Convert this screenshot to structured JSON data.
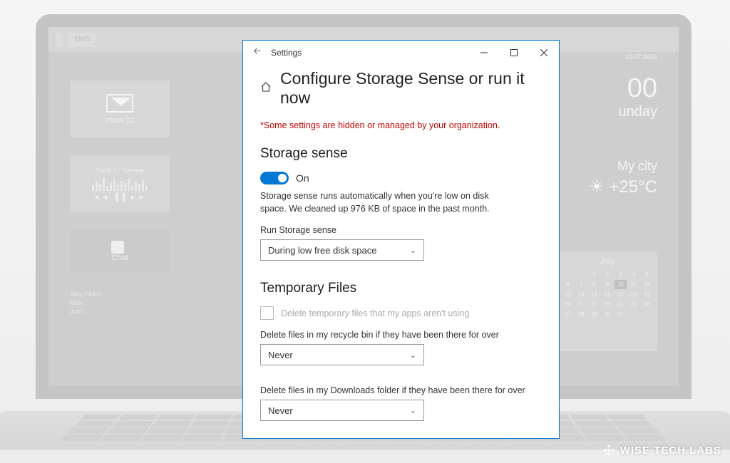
{
  "bg": {
    "taskbar": {
      "lang": "ENG"
    },
    "left_tiles": {
      "mail_label": "inbox 12",
      "track_label": "Track 1 - Sample",
      "chat_label": "Chat",
      "names": [
        "Alex Hello!",
        "Max …",
        "John …"
      ]
    },
    "right": {
      "time": "00",
      "day": "unday",
      "date": "10.07.2015",
      "city": "My city",
      "temp": "+25°C",
      "cal_month": "July"
    }
  },
  "window": {
    "title": "Settings",
    "page_title": "Configure Storage Sense or run it now",
    "warning": "*Some settings are hidden or managed by your organization.",
    "storage_sense": {
      "heading": "Storage sense",
      "toggle_label": "On",
      "description": "Storage sense runs automatically when you're low on disk space. We cleaned up 976 KB of space in the past month.",
      "run_label": "Run Storage sense",
      "run_value": "During low free disk space"
    },
    "temp_files": {
      "heading": "Temporary Files",
      "delete_temp_label": "Delete temporary files that my apps aren't using",
      "recycle_label": "Delete files in my recycle bin if they have been there for over",
      "recycle_value": "Never",
      "downloads_label": "Delete files in my Downloads folder if they have been there for over",
      "downloads_value": "Never"
    }
  },
  "watermark": "WISE TECH LABS"
}
